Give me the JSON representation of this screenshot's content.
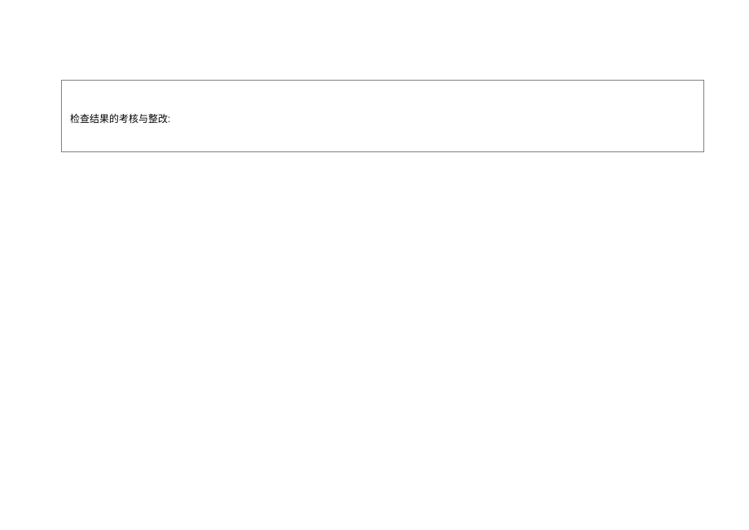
{
  "form": {
    "section_label": "检查结果的考核与整改:"
  }
}
